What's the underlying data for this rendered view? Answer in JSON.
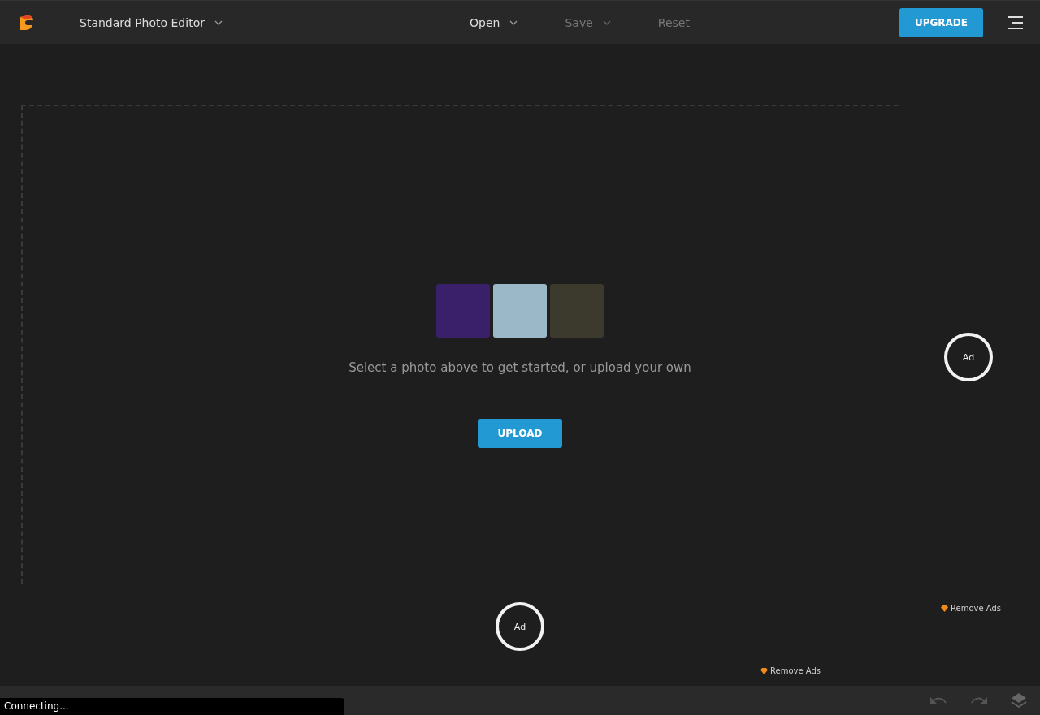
{
  "header": {
    "editor_mode": "Standard Photo Editor",
    "menu": [
      {
        "label": "Open",
        "disabled": false,
        "dropdown": true
      },
      {
        "label": "Save",
        "disabled": true,
        "dropdown": true
      },
      {
        "label": "Reset",
        "disabled": true,
        "dropdown": false
      }
    ],
    "upgrade_button": "UPGRADE"
  },
  "start_panel": {
    "sample_photos": [
      {
        "kind": "photo"
      },
      {
        "kind": "photo"
      },
      {
        "kind": "photo"
      }
    ],
    "prompt": "Select a photo above to get started, or upload your own",
    "upload_button": "UPLOAD"
  },
  "ads": [
    {
      "label": "Ad",
      "remove_label": "Remove Ads"
    },
    {
      "label": "Ad",
      "remove_label": "Remove Ads"
    }
  ],
  "status": "Connecting..."
}
